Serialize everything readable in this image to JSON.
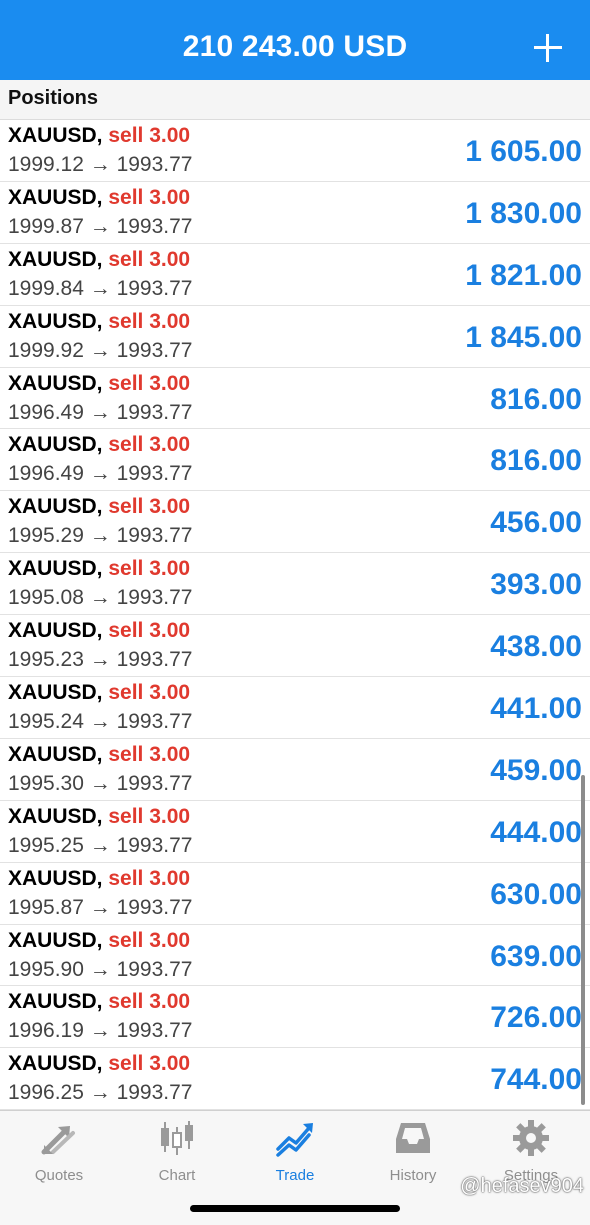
{
  "header": {
    "balance": "210 243.00 USD",
    "add_icon": "plus-icon"
  },
  "section": {
    "title": "Positions"
  },
  "positions": [
    {
      "symbol": "XAUUSD,",
      "side": "sell 3.00",
      "prices": "1999.12 → 1993.77",
      "profit": "1 605.00"
    },
    {
      "symbol": "XAUUSD,",
      "side": "sell 3.00",
      "prices": "1999.87 → 1993.77",
      "profit": "1 830.00"
    },
    {
      "symbol": "XAUUSD,",
      "side": "sell 3.00",
      "prices": "1999.84 → 1993.77",
      "profit": "1 821.00"
    },
    {
      "symbol": "XAUUSD,",
      "side": "sell 3.00",
      "prices": "1999.92 → 1993.77",
      "profit": "1 845.00"
    },
    {
      "symbol": "XAUUSD,",
      "side": "sell 3.00",
      "prices": "1996.49 → 1993.77",
      "profit": "816.00"
    },
    {
      "symbol": "XAUUSD,",
      "side": "sell 3.00",
      "prices": "1996.49 → 1993.77",
      "profit": "816.00"
    },
    {
      "symbol": "XAUUSD,",
      "side": "sell 3.00",
      "prices": "1995.29 → 1993.77",
      "profit": "456.00"
    },
    {
      "symbol": "XAUUSD,",
      "side": "sell 3.00",
      "prices": "1995.08 → 1993.77",
      "profit": "393.00"
    },
    {
      "symbol": "XAUUSD,",
      "side": "sell 3.00",
      "prices": "1995.23 → 1993.77",
      "profit": "438.00"
    },
    {
      "symbol": "XAUUSD,",
      "side": "sell 3.00",
      "prices": "1995.24 → 1993.77",
      "profit": "441.00"
    },
    {
      "symbol": "XAUUSD,",
      "side": "sell 3.00",
      "prices": "1995.30 → 1993.77",
      "profit": "459.00"
    },
    {
      "symbol": "XAUUSD,",
      "side": "sell 3.00",
      "prices": "1995.25 → 1993.77",
      "profit": "444.00"
    },
    {
      "symbol": "XAUUSD,",
      "side": "sell 3.00",
      "prices": "1995.87 → 1993.77",
      "profit": "630.00"
    },
    {
      "symbol": "XAUUSD,",
      "side": "sell 3.00",
      "prices": "1995.90 → 1993.77",
      "profit": "639.00"
    },
    {
      "symbol": "XAUUSD,",
      "side": "sell 3.00",
      "prices": "1996.19 → 1993.77",
      "profit": "726.00"
    },
    {
      "symbol": "XAUUSD,",
      "side": "sell 3.00",
      "prices": "1996.25 → 1993.77",
      "profit": "744.00"
    }
  ],
  "tabs": [
    {
      "label": "Quotes",
      "icon": "quotes-arrows-icon"
    },
    {
      "label": "Chart",
      "icon": "candlestick-chart-icon"
    },
    {
      "label": "Trade",
      "icon": "trade-trend-icon"
    },
    {
      "label": "History",
      "icon": "inbox-tray-icon"
    },
    {
      "label": "Settings",
      "icon": "gear-icon"
    }
  ],
  "active_tab": "Trade",
  "watermark": "@hefasev904",
  "colors": {
    "header_bg": "#1a8cf0",
    "sell": "#e0392e",
    "profit": "#1a7fe0",
    "tab_active": "#1a7fe0",
    "tab_inactive": "#8e8e8e"
  }
}
